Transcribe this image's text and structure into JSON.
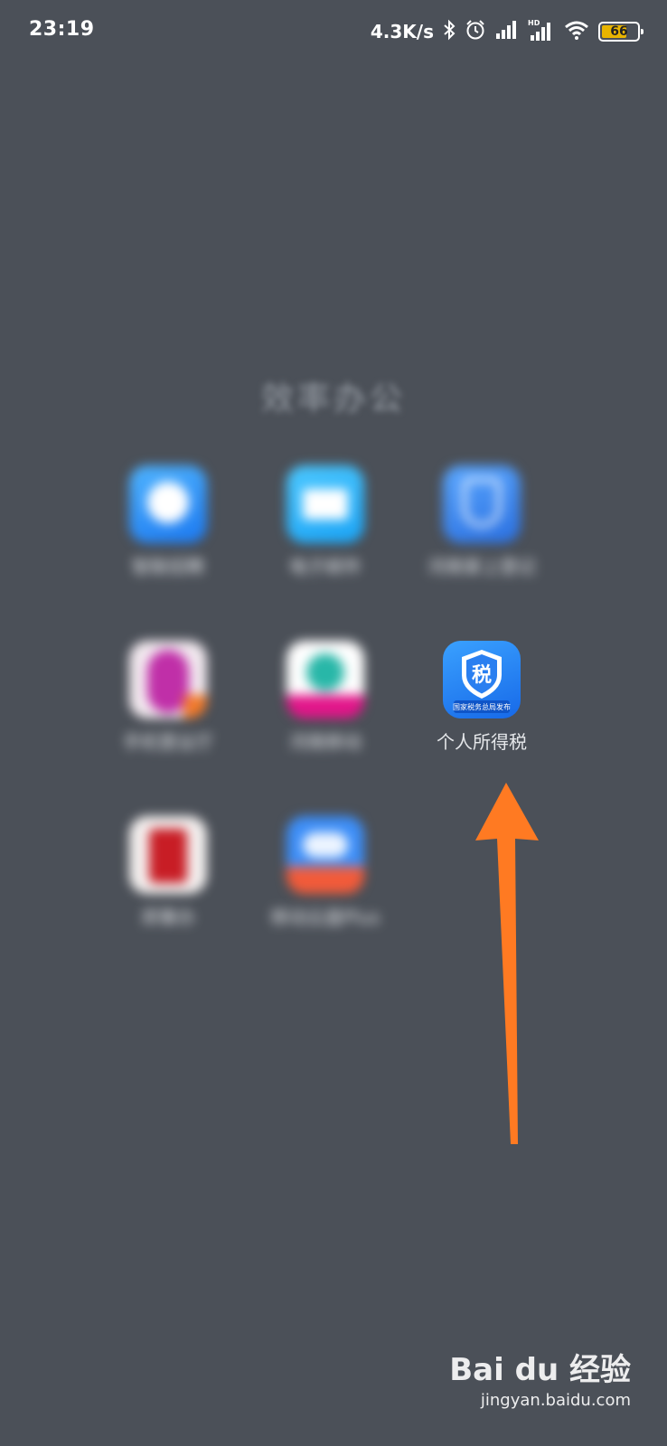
{
  "status_bar": {
    "time": "23:19",
    "net_speed": "4.3K/s",
    "battery": "66"
  },
  "folder": {
    "title": "效率办公",
    "apps": [
      {
        "label": "智联招聘",
        "icon": "zhilian-zhaopin-icon"
      },
      {
        "label": "电子邮件",
        "icon": "mail-icon"
      },
      {
        "label": "河南掌上登记",
        "icon": "henan-dengji-icon"
      },
      {
        "label": "手机营业厅",
        "icon": "mobile-hall-icon"
      },
      {
        "label": "河南移动",
        "icon": "henan-mobile-icon"
      },
      {
        "label": "个人所得税",
        "icon": "tax-icon",
        "icon_char": "税",
        "icon_caption": "国家税务总局发布"
      },
      {
        "label": "郑事办",
        "icon": "zhengshiban-icon"
      },
      {
        "label": "移动云盘Plus",
        "icon": "cloud-plus-icon"
      }
    ]
  },
  "annotation": {
    "arrow_color": "#ff7a22"
  },
  "watermark": {
    "brand": "Bai du 经验",
    "url": "jingyan.baidu.com"
  }
}
